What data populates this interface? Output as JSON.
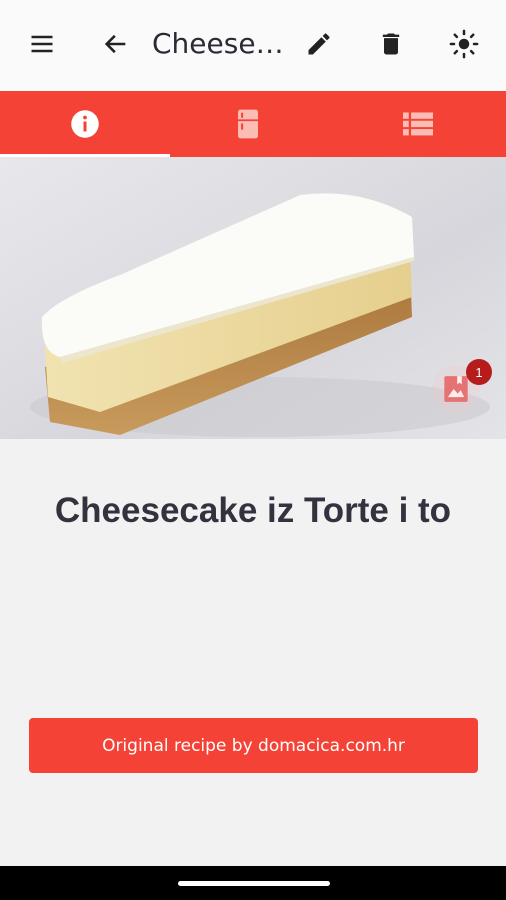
{
  "appbar": {
    "title": "Cheesecake iz Torte i to",
    "icons": [
      "menu-icon",
      "back-arrow-icon",
      "edit-pencil-icon",
      "delete-trash-icon",
      "theme-brightness-icon"
    ]
  },
  "tabs": [
    {
      "icon": "info-icon",
      "selected": true
    },
    {
      "icon": "fridge-icon",
      "selected": false
    },
    {
      "icon": "list-icon",
      "selected": false
    }
  ],
  "gallery": {
    "badge_count": "1",
    "icon": "photo-album-icon"
  },
  "recipe": {
    "title": "Cheesecake iz Torte i to"
  },
  "source_button": {
    "label": "Original recipe by domacica.com.hr"
  },
  "colors": {
    "accent": "#f44336",
    "badge": "#b71c1c",
    "text": "#33333f",
    "background": "#f2f2f2"
  }
}
